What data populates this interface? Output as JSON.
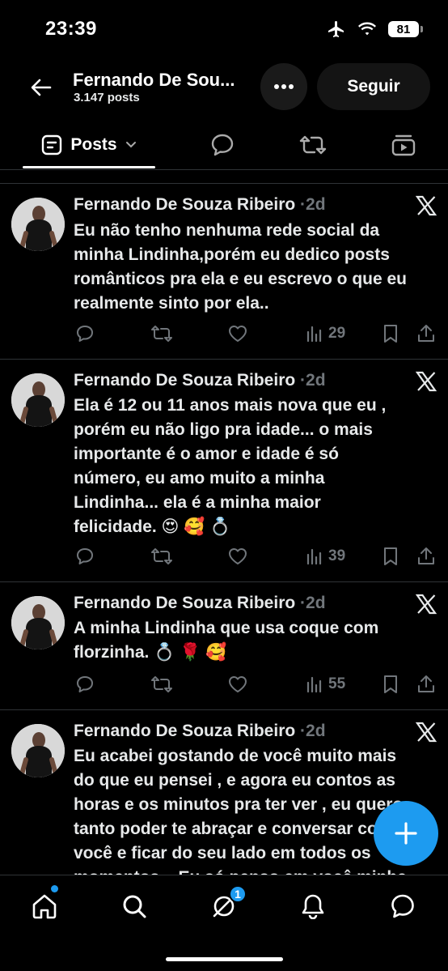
{
  "status_bar": {
    "time": "23:39",
    "battery": "81"
  },
  "header": {
    "name": "Fernando De Sou...",
    "post_count": "3.147 posts",
    "follow_label": "Seguir"
  },
  "tabs": {
    "posts_label": "Posts"
  },
  "posts": [
    {
      "author": "Fernando De Souza Ribeiro",
      "date": "·2d",
      "lines": [
        "Eu não tenho nenhuma rede social da",
        "minha Lindinha,porém eu dedico posts",
        "românticos pra ela e eu escrevo o que eu",
        "realmente sinto por ela.."
      ],
      "views": "29"
    },
    {
      "author": "Fernando De Souza Ribeiro",
      "date": "·2d",
      "lines": [
        "Ela é 12 ou 11 anos mais nova que eu ,",
        "porém eu não ligo pra idade... o mais",
        "importante é o amor e idade é só",
        "número,  eu amo muito a minha",
        "Lindinha... ela é a minha maior",
        "felicidade. 😍 🥰 💍"
      ],
      "views": "39"
    },
    {
      "author": "Fernando De Souza Ribeiro",
      "date": "·2d",
      "lines": [
        "A minha Lindinha que usa coque com",
        "florzinha. 💍 🌹 🥰"
      ],
      "views": "55"
    },
    {
      "author": "Fernando De Souza Ribeiro",
      "date": "·2d",
      "lines": [
        "Eu acabei gostando de você muito mais",
        "do que eu pensei , e agora eu contos as",
        "horas e os minutos pra ter ver , eu quero",
        "tanto poder te abraçar e conversar com",
        "você e ficar do seu lado em todos os",
        "momentos... Eu só penso em você minha"
      ],
      "views": ""
    }
  ],
  "bottom_nav": {
    "messages_badge": "1"
  },
  "colors": {
    "accent": "#1d9bf0",
    "background": "#000000",
    "muted": "#71767b",
    "text": "#e7e9ea"
  }
}
